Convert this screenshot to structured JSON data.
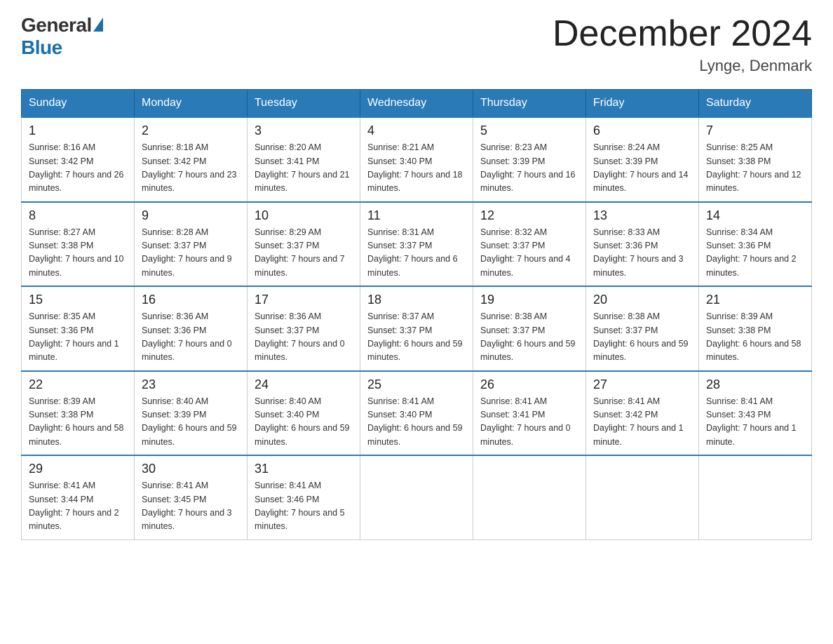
{
  "logo": {
    "general": "General",
    "blue": "Blue"
  },
  "title": "December 2024",
  "subtitle": "Lynge, Denmark",
  "headers": [
    "Sunday",
    "Monday",
    "Tuesday",
    "Wednesday",
    "Thursday",
    "Friday",
    "Saturday"
  ],
  "weeks": [
    [
      {
        "day": "1",
        "sunrise": "8:16 AM",
        "sunset": "3:42 PM",
        "daylight": "7 hours and 26 minutes."
      },
      {
        "day": "2",
        "sunrise": "8:18 AM",
        "sunset": "3:42 PM",
        "daylight": "7 hours and 23 minutes."
      },
      {
        "day": "3",
        "sunrise": "8:20 AM",
        "sunset": "3:41 PM",
        "daylight": "7 hours and 21 minutes."
      },
      {
        "day": "4",
        "sunrise": "8:21 AM",
        "sunset": "3:40 PM",
        "daylight": "7 hours and 18 minutes."
      },
      {
        "day": "5",
        "sunrise": "8:23 AM",
        "sunset": "3:39 PM",
        "daylight": "7 hours and 16 minutes."
      },
      {
        "day": "6",
        "sunrise": "8:24 AM",
        "sunset": "3:39 PM",
        "daylight": "7 hours and 14 minutes."
      },
      {
        "day": "7",
        "sunrise": "8:25 AM",
        "sunset": "3:38 PM",
        "daylight": "7 hours and 12 minutes."
      }
    ],
    [
      {
        "day": "8",
        "sunrise": "8:27 AM",
        "sunset": "3:38 PM",
        "daylight": "7 hours and 10 minutes."
      },
      {
        "day": "9",
        "sunrise": "8:28 AM",
        "sunset": "3:37 PM",
        "daylight": "7 hours and 9 minutes."
      },
      {
        "day": "10",
        "sunrise": "8:29 AM",
        "sunset": "3:37 PM",
        "daylight": "7 hours and 7 minutes."
      },
      {
        "day": "11",
        "sunrise": "8:31 AM",
        "sunset": "3:37 PM",
        "daylight": "7 hours and 6 minutes."
      },
      {
        "day": "12",
        "sunrise": "8:32 AM",
        "sunset": "3:37 PM",
        "daylight": "7 hours and 4 minutes."
      },
      {
        "day": "13",
        "sunrise": "8:33 AM",
        "sunset": "3:36 PM",
        "daylight": "7 hours and 3 minutes."
      },
      {
        "day": "14",
        "sunrise": "8:34 AM",
        "sunset": "3:36 PM",
        "daylight": "7 hours and 2 minutes."
      }
    ],
    [
      {
        "day": "15",
        "sunrise": "8:35 AM",
        "sunset": "3:36 PM",
        "daylight": "7 hours and 1 minute."
      },
      {
        "day": "16",
        "sunrise": "8:36 AM",
        "sunset": "3:36 PM",
        "daylight": "7 hours and 0 minutes."
      },
      {
        "day": "17",
        "sunrise": "8:36 AM",
        "sunset": "3:37 PM",
        "daylight": "7 hours and 0 minutes."
      },
      {
        "day": "18",
        "sunrise": "8:37 AM",
        "sunset": "3:37 PM",
        "daylight": "6 hours and 59 minutes."
      },
      {
        "day": "19",
        "sunrise": "8:38 AM",
        "sunset": "3:37 PM",
        "daylight": "6 hours and 59 minutes."
      },
      {
        "day": "20",
        "sunrise": "8:38 AM",
        "sunset": "3:37 PM",
        "daylight": "6 hours and 59 minutes."
      },
      {
        "day": "21",
        "sunrise": "8:39 AM",
        "sunset": "3:38 PM",
        "daylight": "6 hours and 58 minutes."
      }
    ],
    [
      {
        "day": "22",
        "sunrise": "8:39 AM",
        "sunset": "3:38 PM",
        "daylight": "6 hours and 58 minutes."
      },
      {
        "day": "23",
        "sunrise": "8:40 AM",
        "sunset": "3:39 PM",
        "daylight": "6 hours and 59 minutes."
      },
      {
        "day": "24",
        "sunrise": "8:40 AM",
        "sunset": "3:40 PM",
        "daylight": "6 hours and 59 minutes."
      },
      {
        "day": "25",
        "sunrise": "8:41 AM",
        "sunset": "3:40 PM",
        "daylight": "6 hours and 59 minutes."
      },
      {
        "day": "26",
        "sunrise": "8:41 AM",
        "sunset": "3:41 PM",
        "daylight": "7 hours and 0 minutes."
      },
      {
        "day": "27",
        "sunrise": "8:41 AM",
        "sunset": "3:42 PM",
        "daylight": "7 hours and 1 minute."
      },
      {
        "day": "28",
        "sunrise": "8:41 AM",
        "sunset": "3:43 PM",
        "daylight": "7 hours and 1 minute."
      }
    ],
    [
      {
        "day": "29",
        "sunrise": "8:41 AM",
        "sunset": "3:44 PM",
        "daylight": "7 hours and 2 minutes."
      },
      {
        "day": "30",
        "sunrise": "8:41 AM",
        "sunset": "3:45 PM",
        "daylight": "7 hours and 3 minutes."
      },
      {
        "day": "31",
        "sunrise": "8:41 AM",
        "sunset": "3:46 PM",
        "daylight": "7 hours and 5 minutes."
      },
      null,
      null,
      null,
      null
    ]
  ]
}
